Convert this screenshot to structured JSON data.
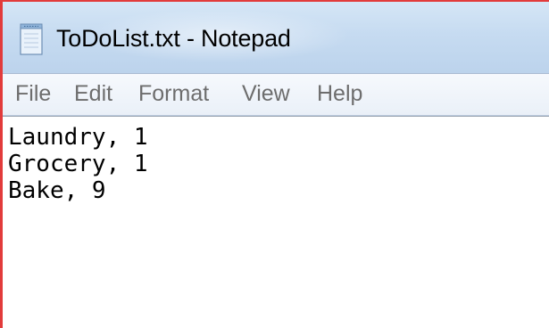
{
  "window": {
    "title": "ToDoList.txt - Notepad",
    "icon": "notepad-icon"
  },
  "menubar": {
    "items": [
      "File",
      "Edit",
      "Format",
      "View",
      "Help"
    ]
  },
  "editor": {
    "lines": [
      "Laundry, 1",
      "Grocery, 1",
      "Bake, 9"
    ]
  },
  "colors": {
    "window_border": "#e23b3b",
    "titlebar": "#c6dbf1",
    "menu_text": "#6d6d6d"
  }
}
